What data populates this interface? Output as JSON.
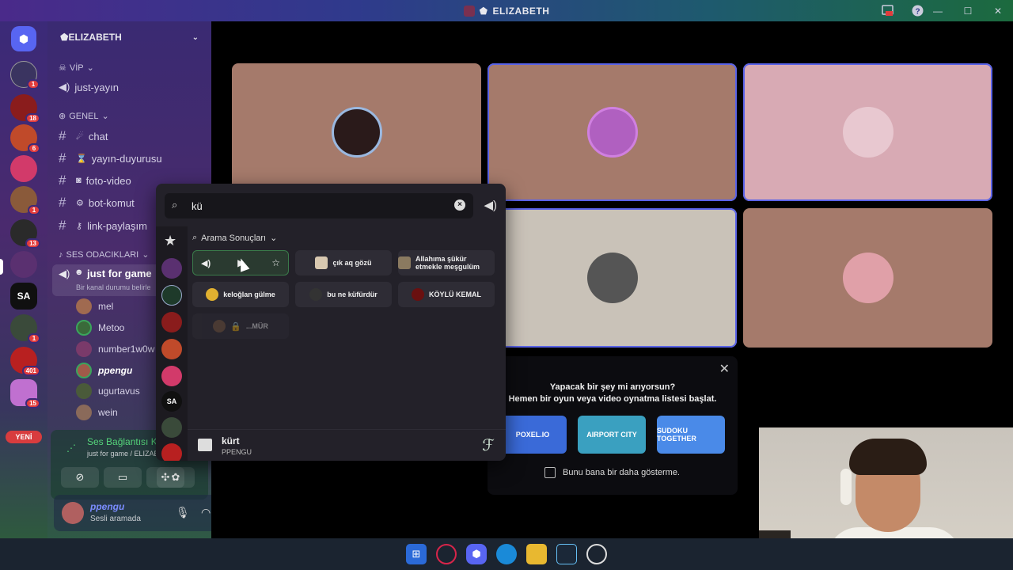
{
  "window": {
    "title": "ELIZABETH",
    "controls": [
      "—",
      "☐",
      "✕"
    ]
  },
  "rail": {
    "badges": [
      "1",
      "18",
      "6",
      "1",
      "13",
      "1",
      "401",
      "15"
    ],
    "new_label": "YENİ",
    "servers": [
      {
        "color": "#3a3460",
        "badge": "1"
      },
      {
        "color": "#8a1c1c",
        "badge": "18"
      },
      {
        "color": "#c04a2a",
        "badge": "6"
      },
      {
        "color": "#d23a6a",
        "badge": ""
      },
      {
        "color": "#8a5a3a",
        "badge": "1"
      },
      {
        "color": "#2a2a2a",
        "badge": "13"
      },
      {
        "color": "#5a3070",
        "badge": ""
      },
      {
        "color": "#101010",
        "badge": "",
        "text": "SA"
      },
      {
        "color": "#3a4a3a",
        "badge": "1"
      },
      {
        "color": "#b82020",
        "badge": "401"
      },
      {
        "color": "#c070d0",
        "badge": "15"
      }
    ]
  },
  "sidebar": {
    "server_name": "ELIZABETH",
    "categories": {
      "vip": "VİP",
      "genel": "GENEL",
      "ses": "SES ODACIKLARI"
    },
    "channels": {
      "just_yayin": "just-yayın",
      "chat": "chat",
      "yayin_duyurusu": "yayın-duyurusu",
      "foto_video": "foto-video",
      "bot_komut": "bot-komut",
      "link_paylasim": "link-paylaşım"
    },
    "voice_channel": {
      "name": "just for game",
      "status": "Bir kanal durumu belirle"
    },
    "members": [
      "mel",
      "Metoo",
      "number1w0w",
      "ppengu",
      "ugurtavus",
      "wein"
    ],
    "voice_panel": {
      "status": "Ses Bağlantısı Kuruldu",
      "sub": "just for game / ELIZAB..."
    },
    "user": {
      "name": "ppengu",
      "status": "Sesli aramada"
    }
  },
  "soundboard": {
    "query": "kü",
    "results_label": "Arama Sonuçları",
    "sounds": [
      {
        "name": "çık aq gözü",
        "color": "#d8c8b0"
      },
      {
        "name": "Allahıma şükür etmekle meşgulüm",
        "color": "#8a7a60"
      },
      {
        "name": "keloğlan gülme",
        "color": "#e0b030"
      },
      {
        "name": "bu ne küfürdür",
        "color": "#333"
      },
      {
        "name": "KÖYLÜ KEMAL",
        "color": "#6a1010"
      },
      {
        "name": "...MÜR",
        "color": "#7a5a40"
      }
    ],
    "footer": {
      "name": "kürt",
      "author": "PPENGU"
    }
  },
  "prompt": {
    "line1": "Yapacak bir şey mi arıyorsun?",
    "line2": "Hemen bir oyun veya video oynatma listesi başlat.",
    "games": [
      {
        "label": "POXEL.IO",
        "color": "#3a6ad8"
      },
      {
        "label": "AIRPORT CITY",
        "color": "#3aa0c0"
      },
      {
        "label": "SUDOKU TOGETHER",
        "color": "#4a8ae8"
      }
    ],
    "checkbox": "Bunu bana bir daha gösterme."
  },
  "tiles": [
    {
      "bg": "#a57a6b",
      "av": "#2a1a1a",
      "selected": false
    },
    {
      "bg": "#a57a6b",
      "av": "#b060c0",
      "selected": true
    },
    {
      "bg": "#d8aab4",
      "av": "#e8c8d0",
      "selected": true
    },
    {
      "bg": "#c9c2b8",
      "av": "#555",
      "selected": true
    },
    {
      "bg": "#a57a6b",
      "av": "#e0a0a8",
      "selected": false
    }
  ]
}
